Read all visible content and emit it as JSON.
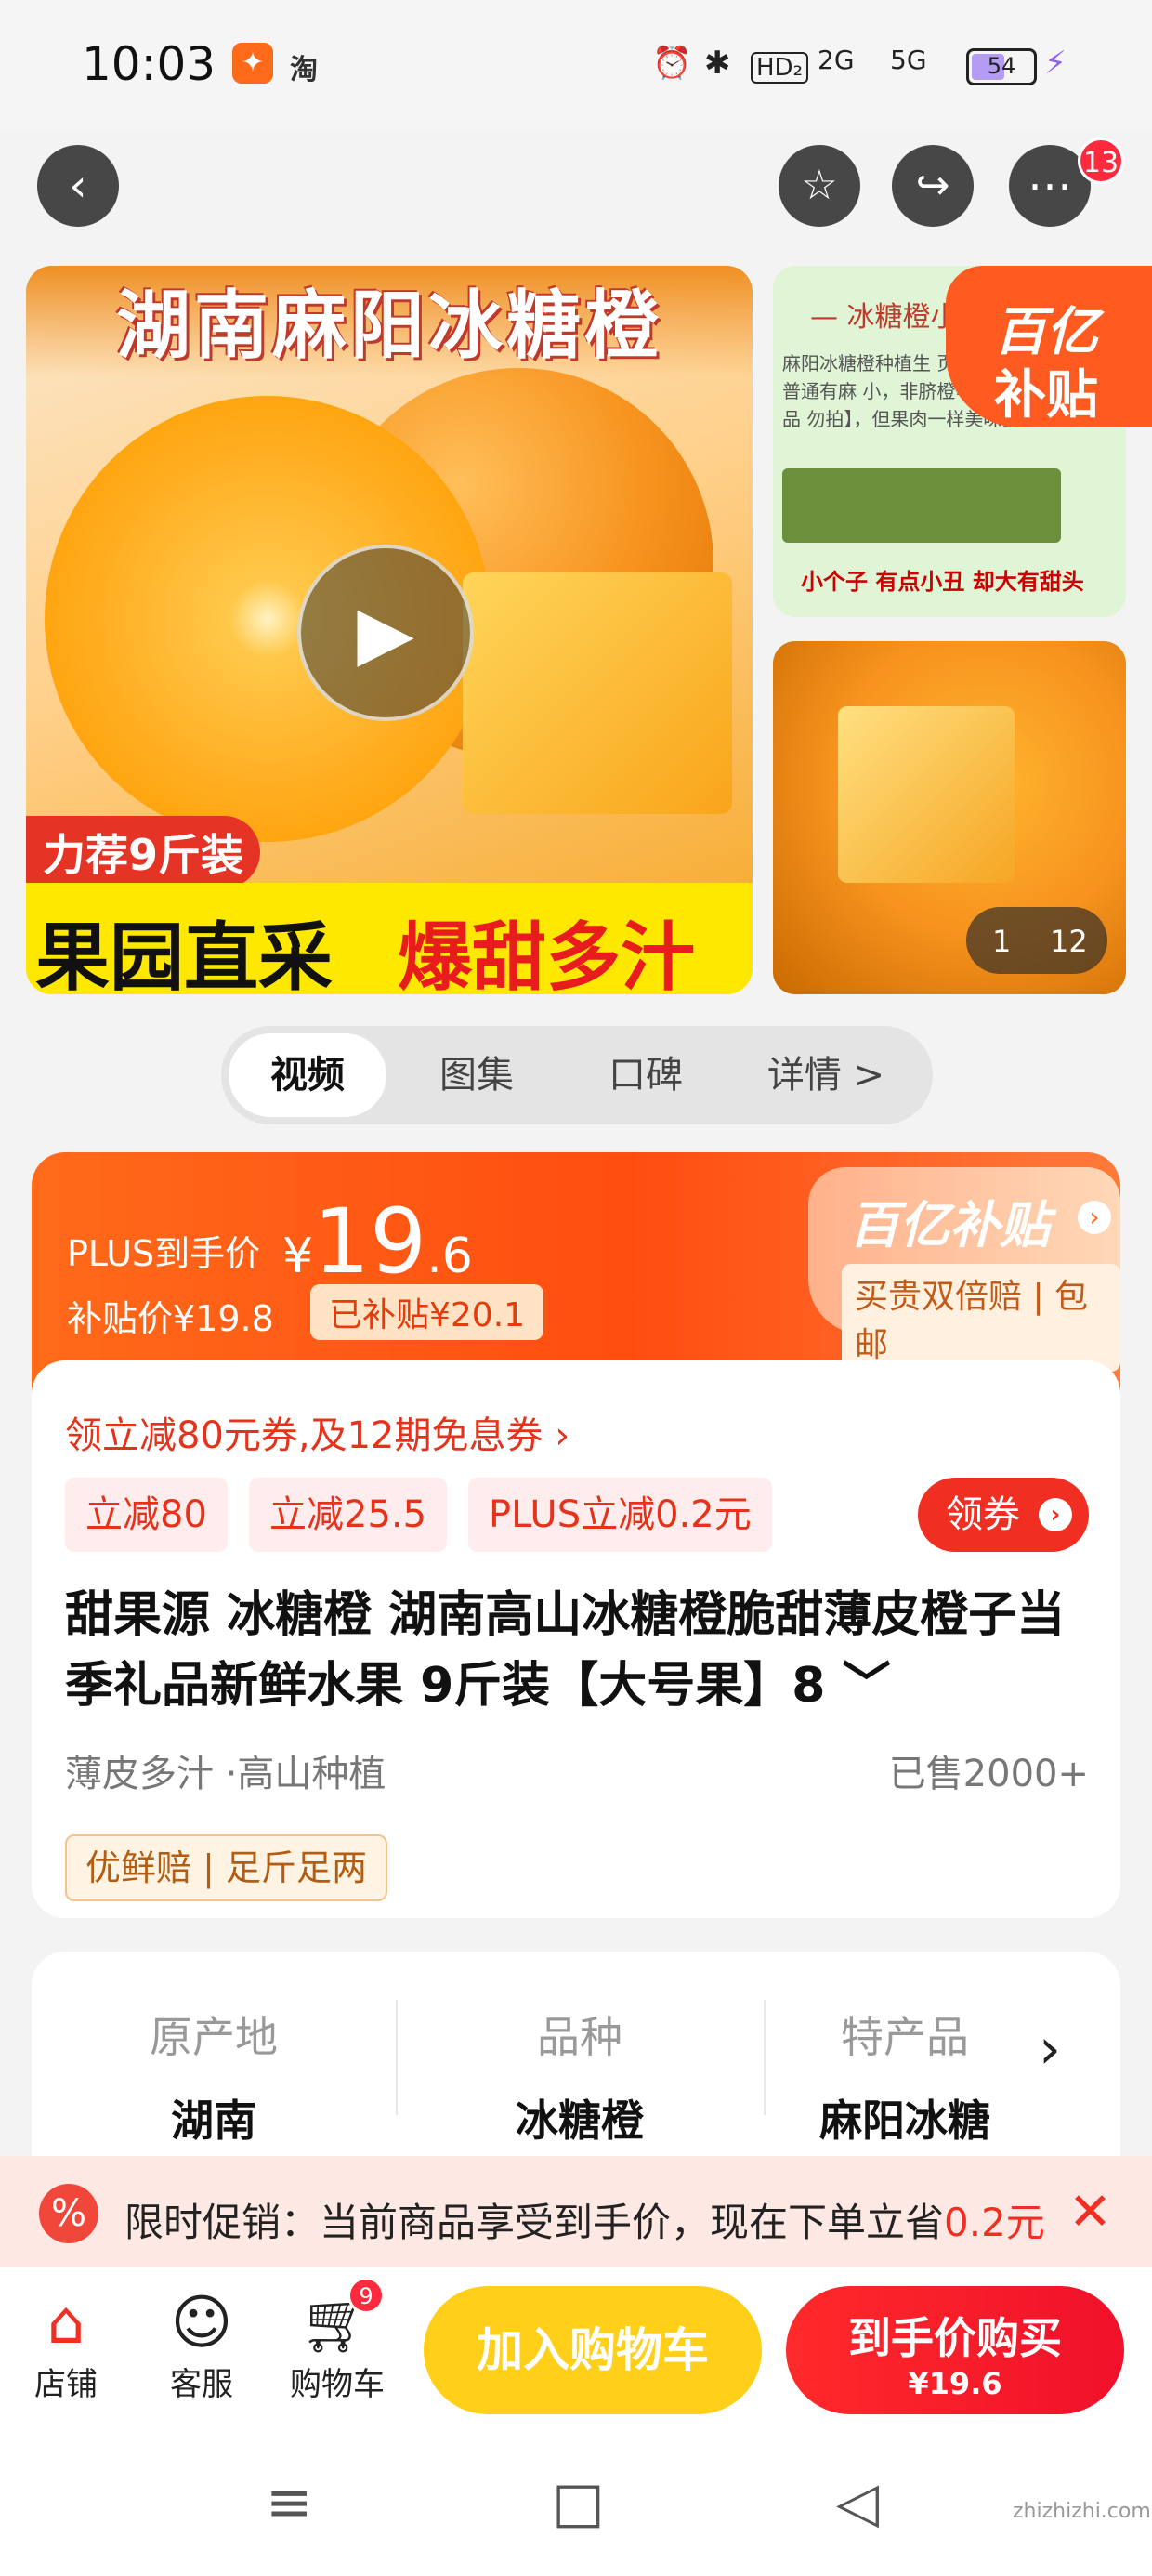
{
  "status_bar": {
    "time": "10:03",
    "app_badge": "淘",
    "network": "HD₂",
    "signal1": "2G",
    "signal2": "5G",
    "battery": "54",
    "battery_level": 0.54
  },
  "nav": {
    "more_badge": "13"
  },
  "gallery": {
    "main_title": "湖南麻阳冰糖橙",
    "tag": "力荐9斤装",
    "banner_left": "果园直采",
    "banner_right": "爆甜多汁",
    "thumb1_title": "— 冰糖橙小",
    "thumb1_text": "麻阳冰糖橙种植生 页岩中，表皮普通有麻 小，非脐橙等其他橙子品 勿拍】，但果肉一样美味多汁",
    "thumb1_caption": "小个子 有点小丑 却大有甜头",
    "yi_line1": "百亿",
    "yi_line2": "补贴",
    "counter_current": "1",
    "counter_total": "12"
  },
  "tabs": [
    "视频",
    "图集",
    "口碑",
    "详情 >"
  ],
  "price": {
    "plus_label": "PLUS到手价",
    "currency": "¥",
    "int": "19",
    "dec": ".6",
    "subsidy_price": "补贴价¥19.8",
    "subsidy_badge": "已补贴¥20.1",
    "yi_brand": "百亿补贴",
    "guarantee": "买贵双倍赔 | 包邮"
  },
  "product": {
    "coupon_line": "领立减80元券,及12期免息券 ›",
    "chips": [
      "立减80",
      "立减25.5",
      "PLUS立减0.2元"
    ],
    "get_coupon": "领券",
    "title": "甜果源 冰糖橙 湖南高山冰糖橙脆甜薄皮橙子当季礼品新鲜水果 9斤装【大号果】8 ﹀",
    "features": "薄皮多汁 ·高山种植",
    "sold": "已售2000+",
    "badges": "优鲜赔 | 足斤足两"
  },
  "attributes": [
    {
      "key": "原产地",
      "value": "湖南"
    },
    {
      "key": "品种",
      "value": "冰糖橙"
    },
    {
      "key": "特产品",
      "value": "麻阳冰糖"
    }
  ],
  "promo": {
    "text": "限时促销：当前商品享受到手价，现在下单立省",
    "amount": "0.2元"
  },
  "bottom": {
    "shop": "店铺",
    "service": "客服",
    "cart": "购物车",
    "cart_badge": "9",
    "add_to_cart": "加入购物车",
    "buy_label": "到手价购买",
    "buy_price": "¥19.6"
  },
  "watermark": "zhizhizhi.com",
  "colors": {
    "accent": "#ff4d10",
    "buy_red": "#f0112a",
    "cart_yellow": "#ffcf1a"
  }
}
